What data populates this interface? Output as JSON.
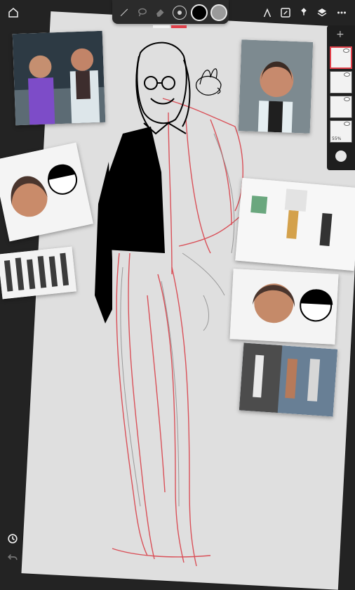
{
  "toolbar": {
    "left": [
      {
        "name": "home-icon"
      }
    ],
    "center": [
      {
        "name": "brush-icon"
      },
      {
        "name": "lasso-icon"
      },
      {
        "name": "eraser-icon"
      },
      {
        "name": "brush-size-icon"
      },
      {
        "name": "color-black-swatch"
      },
      {
        "name": "color-gray-swatch"
      }
    ],
    "right": [
      {
        "name": "ruler-icon"
      },
      {
        "name": "edit-icon"
      },
      {
        "name": "pin-icon"
      },
      {
        "name": "layers-icon"
      },
      {
        "name": "more-icon"
      }
    ],
    "colors": {
      "primary": "#000000",
      "secondary": "#9a9a9a",
      "accent": "#e0404a"
    }
  },
  "layers_panel": {
    "add_label": "+",
    "layers": [
      {
        "name": "layer-1",
        "active": true
      },
      {
        "name": "layer-2",
        "active": false
      },
      {
        "name": "layer-3",
        "active": false
      },
      {
        "name": "layer-4",
        "active": false,
        "opacity_label": "55%"
      }
    ]
  },
  "bottom": [
    {
      "name": "history-icon"
    },
    {
      "name": "undo-icon"
    }
  ]
}
